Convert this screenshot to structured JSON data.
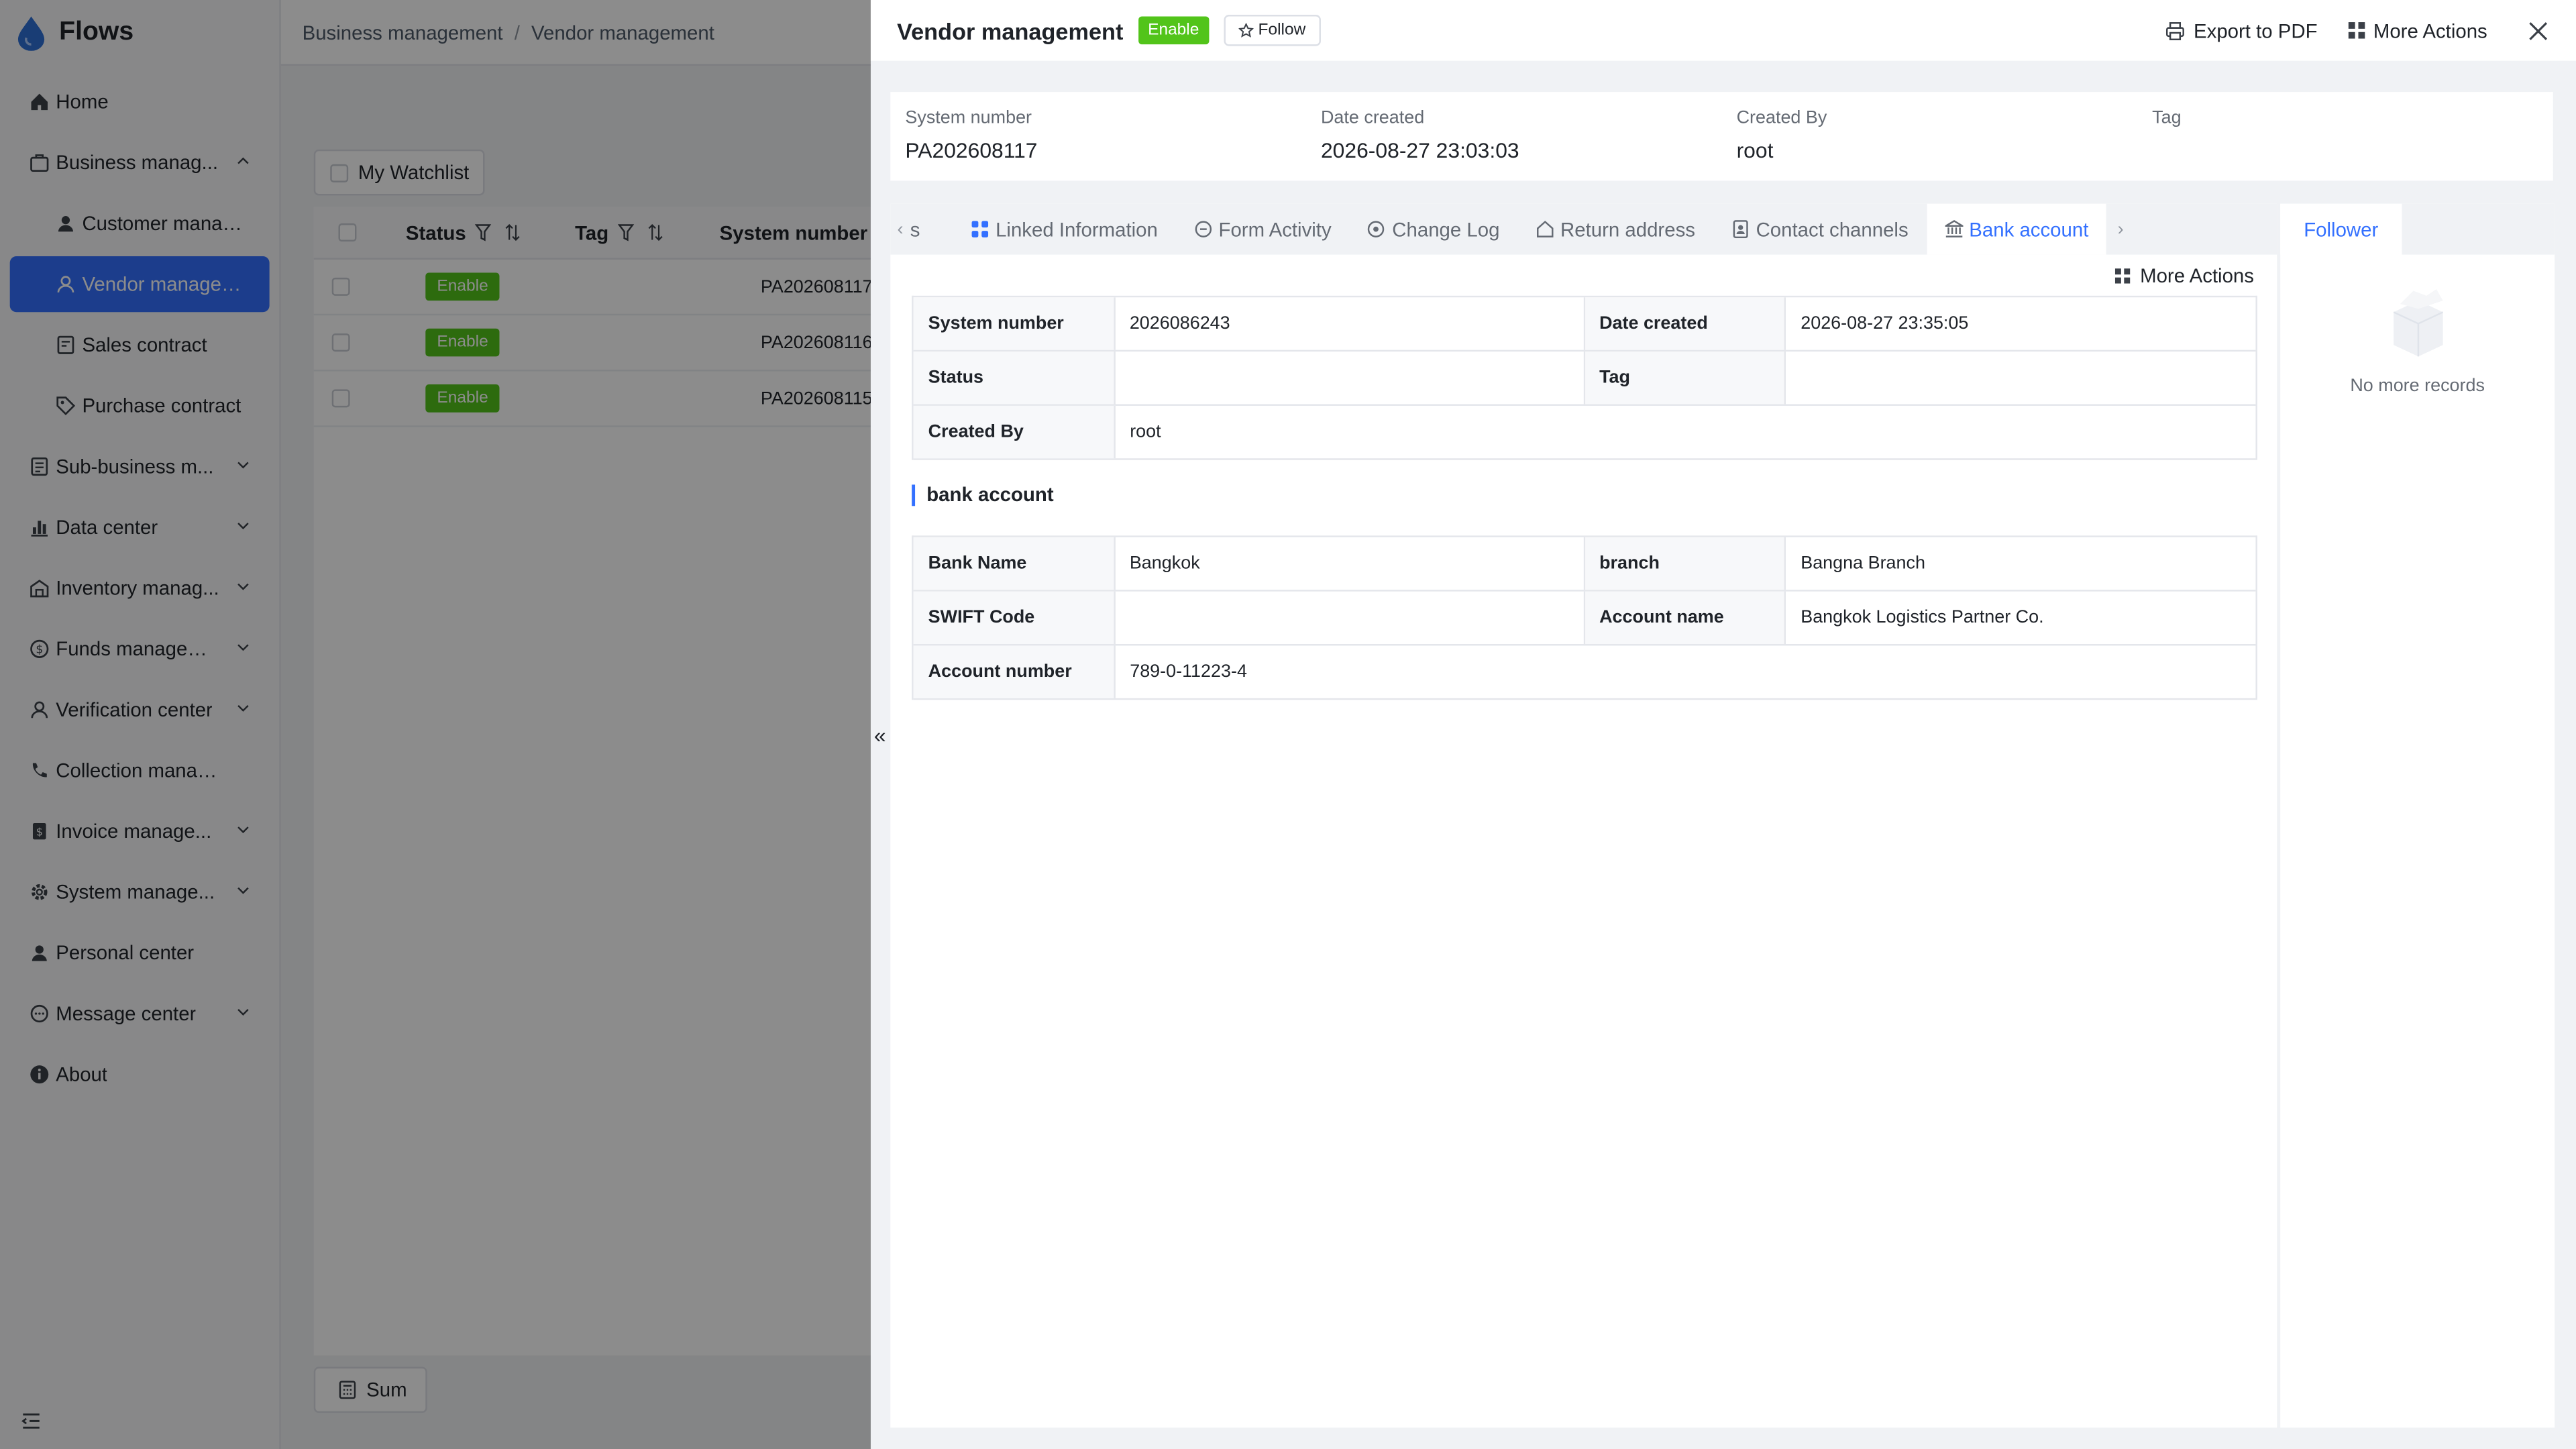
{
  "app": {
    "name": "Flows"
  },
  "sidebar": {
    "items": [
      {
        "label": "Home"
      },
      {
        "label": "Business manag..."
      },
      {
        "label": "Customer manag..."
      },
      {
        "label": "Vendor managem..."
      },
      {
        "label": "Sales contract"
      },
      {
        "label": "Purchase contract"
      },
      {
        "label": "Sub-business m..."
      },
      {
        "label": "Data center"
      },
      {
        "label": "Inventory manag..."
      },
      {
        "label": "Funds managem..."
      },
      {
        "label": "Verification center"
      },
      {
        "label": "Collection managem..."
      },
      {
        "label": "Invoice manage..."
      },
      {
        "label": "System manage..."
      },
      {
        "label": "Personal center"
      },
      {
        "label": "Message center"
      },
      {
        "label": "About"
      }
    ]
  },
  "breadcrumb": {
    "parent": "Business management",
    "sep": "/",
    "current": "Vendor management"
  },
  "list": {
    "watchlist_label": "My Watchlist",
    "columns": {
      "status": "Status",
      "tag": "Tag",
      "system_number": "System number"
    },
    "rows": [
      {
        "status": "Enable",
        "system_number": "PA202608117"
      },
      {
        "status": "Enable",
        "system_number": "PA202608116"
      },
      {
        "status": "Enable",
        "system_number": "PA202608115"
      }
    ],
    "sum_label": "Sum"
  },
  "drawer": {
    "title": "Vendor management",
    "status": "Enable",
    "follow_label": "Follow",
    "export_label": "Export to PDF",
    "more_actions_label": "More Actions",
    "summary": {
      "system_number_label": "System number",
      "system_number": "PA202608117",
      "date_created_label": "Date created",
      "date_created": "2026-08-27 23:03:03",
      "created_by_label": "Created By",
      "created_by": "root",
      "tag_label": "Tag"
    },
    "tabs": {
      "prev_partial": "s",
      "linked": "Linked Information",
      "form_activity": "Form Activity",
      "change_log": "Change Log",
      "return_address": "Return address",
      "contact_channels": "Contact channels",
      "bank_account": "Bank account",
      "follower": "Follower"
    },
    "record": {
      "more_actions_label": "More Actions",
      "system_number_label": "System number",
      "system_number": "2026086243",
      "date_created_label": "Date created",
      "date_created": "2026-08-27 23:35:05",
      "status_label": "Status",
      "tag_label": "Tag",
      "created_by_label": "Created By",
      "created_by": "root"
    },
    "bank_section": {
      "title": "bank account",
      "bank_name_label": "Bank Name",
      "bank_name": "Bangkok",
      "branch_label": "branch",
      "branch": "Bangna Branch",
      "swift_label": "SWIFT Code",
      "account_name_label": "Account name",
      "account_name": "Bangkok Logistics Partner Co.",
      "account_number_label": "Account number",
      "account_number": "789-0-11223-4"
    },
    "follower_empty": "No more records"
  },
  "colors": {
    "accent": "#3370ff",
    "enable": "#52c41a"
  }
}
